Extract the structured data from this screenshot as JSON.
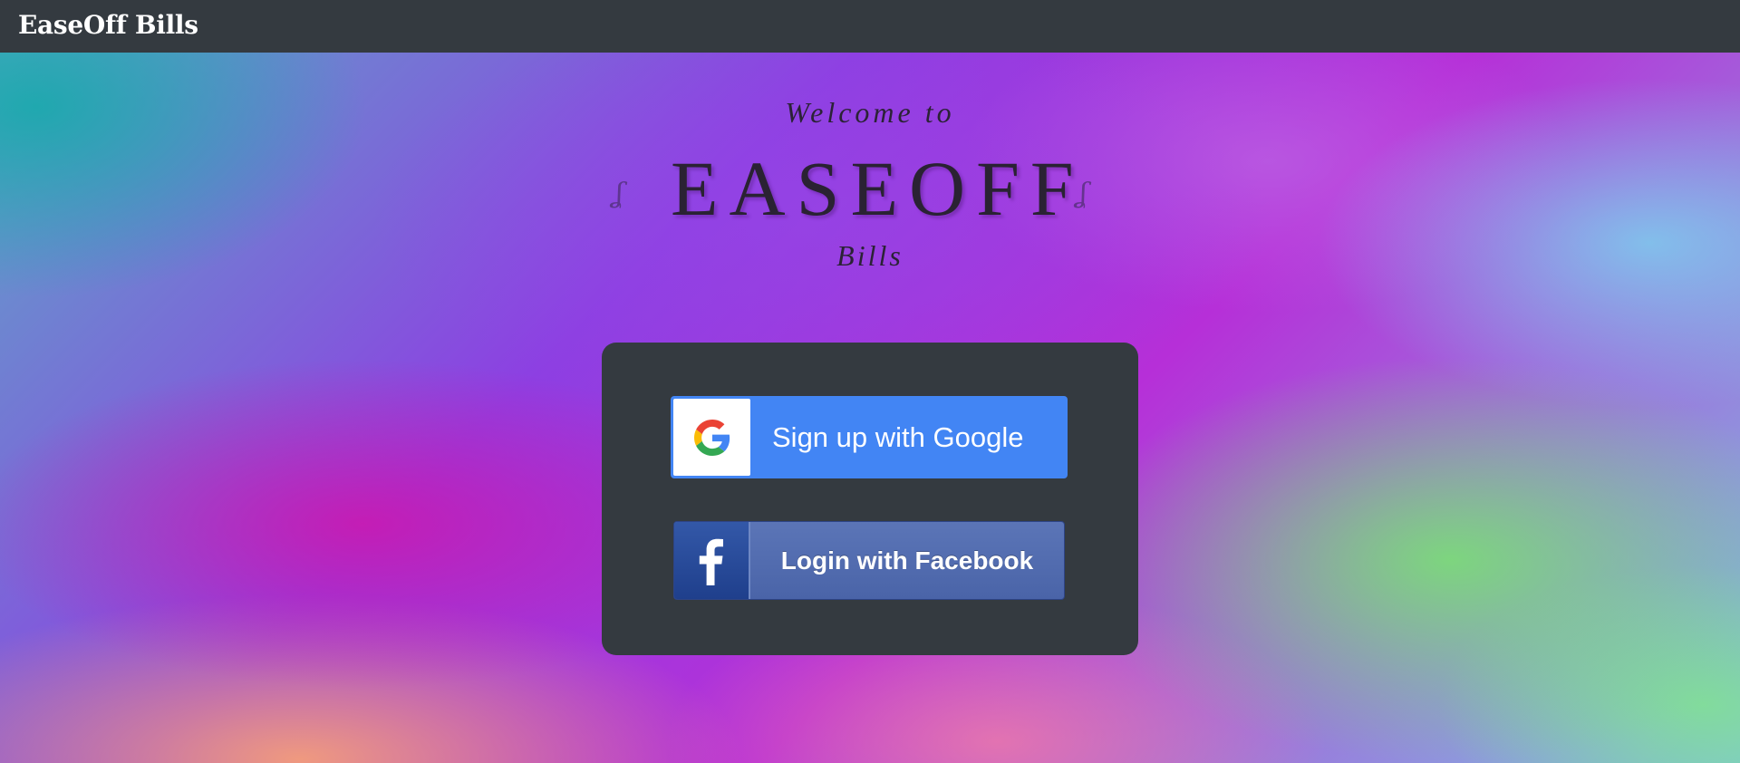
{
  "navbar": {
    "brand": "EaseOff Bills"
  },
  "hero": {
    "welcome": "Welcome to",
    "title": "EASEOFF",
    "subtitle": "Bills",
    "flourish": "ʆ"
  },
  "login": {
    "google_label": "Sign up with Google",
    "facebook_label": "Login with Facebook",
    "google_icon": "google-g-icon",
    "facebook_icon": "facebook-f-icon"
  },
  "colors": {
    "navbar": "#343a40",
    "card": "#343a40",
    "google_blue": "#4285f4",
    "facebook_blue": "#4a64a8"
  }
}
